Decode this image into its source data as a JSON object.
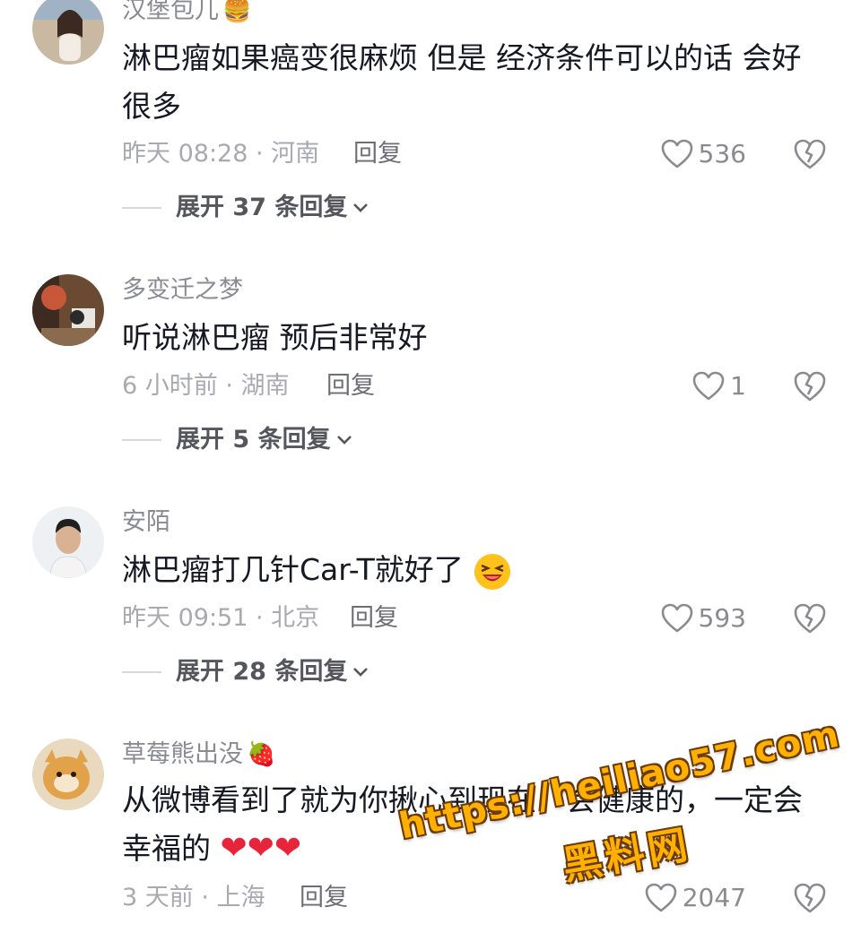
{
  "colors": {
    "username": "#8a8b91",
    "text": "#161823",
    "meta": "#a9aab0",
    "expand": "#55565c",
    "watermark": "#ffb000"
  },
  "comments": [
    {
      "username": "汉堡包儿",
      "username_emoji": "🍔",
      "text": "淋巴瘤如果癌变很麻烦 但是 经济条件可以的话 会好很多",
      "time_location": "昨天 08:28 · 河南",
      "reply_label": "回复",
      "likes": "536",
      "expand_label": "展开 37 条回复"
    },
    {
      "username": "多变迁之梦",
      "username_emoji": "",
      "text": "听说淋巴瘤 预后非常好",
      "time_location": "6 小时前 · 湖南",
      "reply_label": "回复",
      "likes": "1",
      "expand_label": "展开 5 条回复"
    },
    {
      "username": "安陌",
      "username_emoji": "",
      "text": "淋巴瘤打几针Car-T就好了",
      "time_location": "昨天 09:51 · 北京",
      "reply_label": "回复",
      "likes": "593",
      "expand_label": "展开 28 条回复"
    },
    {
      "username": "草莓熊出没",
      "username_emoji": "🍓",
      "text": "从微博看到了就为你揪心到现在，会健康的，一定会幸福的",
      "time_location": "3 天前 · 上海",
      "reply_label": "回复",
      "likes": "2047",
      "expand_label": ""
    }
  ],
  "watermark": {
    "url": "https://heiliao57.com",
    "name": "黑料网"
  },
  "icons": {
    "like": "heart-outline-icon",
    "dislike": "broken-heart-icon",
    "expand": "chevron-down-icon"
  }
}
